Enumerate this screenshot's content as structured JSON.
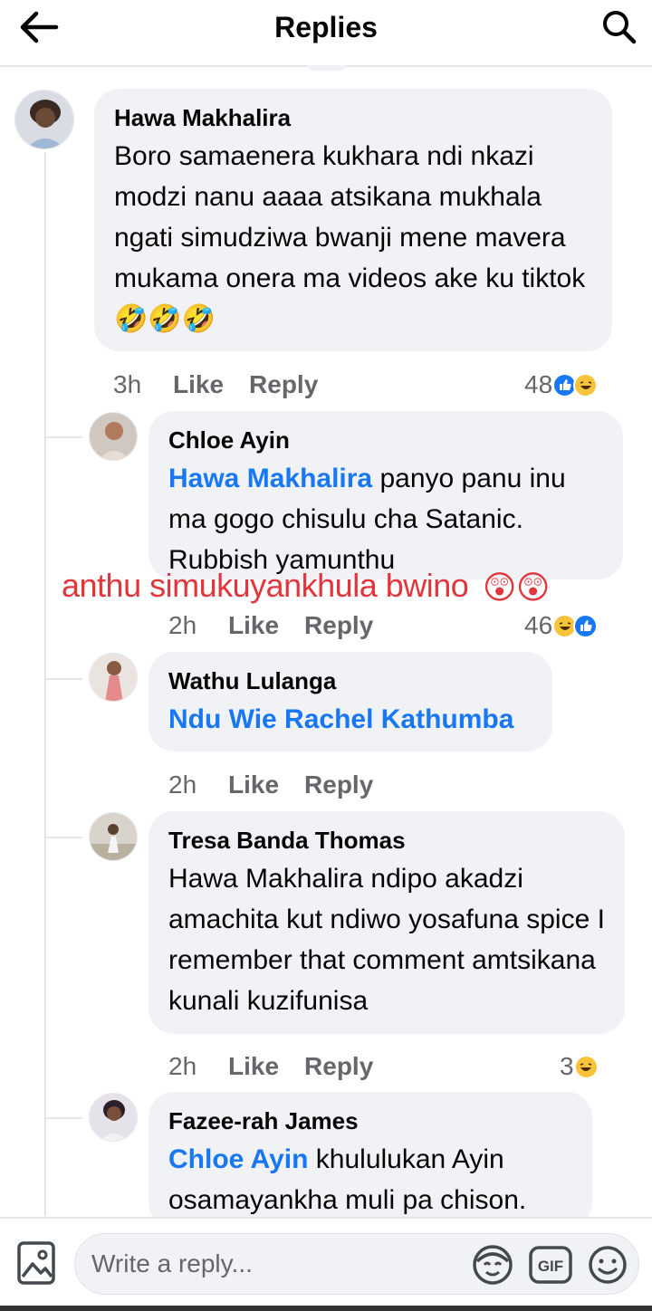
{
  "header": {
    "title": "Replies"
  },
  "comments": [
    {
      "author": "Hawa Makhalira",
      "text": "Boro samaenera kukhara ndi nkazi modzi nanu aaaa atsikana mukhala ngati simudziwa bwanji mene mavera mukama onera ma videos ake ku tiktok",
      "text_emojis": "🤣🤣🤣",
      "time": "3h",
      "like": "Like",
      "reply": "Reply",
      "reaction_count": "48",
      "reactions": [
        "like",
        "haha"
      ]
    },
    {
      "author": "Chloe Ayin",
      "mention": "Hawa Makhalira",
      "text": " panyo panu inu ma gogo chisulu cha Satanic. Rubbish yamunthu",
      "time": "2h",
      "like": "Like",
      "reply": "Reply",
      "reaction_count": "46",
      "reactions": [
        "haha",
        "like"
      ]
    },
    {
      "author": "Wathu Lulanga",
      "mention": "Ndu Wie Rachel Kathumba",
      "text": "",
      "time": "2h",
      "like": "Like",
      "reply": "Reply"
    },
    {
      "author": "Tresa Banda Thomas",
      "text": "Hawa Makhalira ndipo  akadzi amachita kut ndiwo yosafuna spice I remember that comment amtsikana kunali kuzifunisa",
      "time": "2h",
      "like": "Like",
      "reply": "Reply",
      "reaction_count": "3",
      "reactions": [
        "haha"
      ]
    },
    {
      "author": "Fazee-rah James",
      "mention": "Chloe Ayin",
      "text": " khululukan Ayin osamayankha muli pa chison."
    }
  ],
  "overlay": {
    "text": "anthu simukuyankhula bwino",
    "emojis": "😲😲"
  },
  "composer": {
    "placeholder": "Write a reply..."
  },
  "colors": {
    "accent": "#1877f2",
    "overlay": "#e2353c",
    "bubble": "#f0f2f5",
    "meta": "#65676b"
  }
}
